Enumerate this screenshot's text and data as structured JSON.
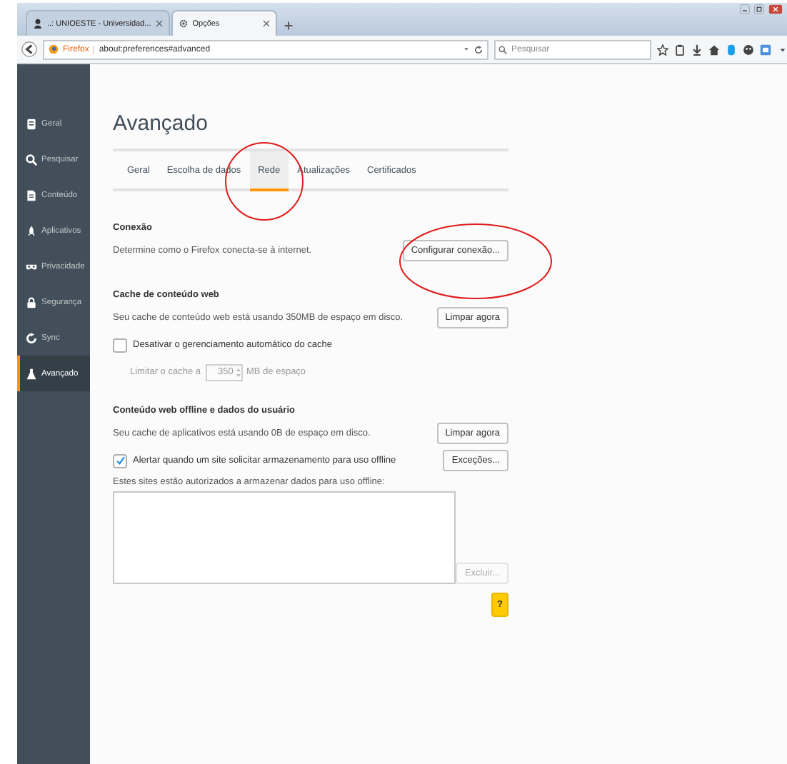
{
  "browser": {
    "tabs": [
      {
        "label": "..: UNIOESTE - Universidad...",
        "selected": false
      },
      {
        "label": "Opções",
        "selected": true
      }
    ],
    "toolbar": {
      "identity": "Firefox",
      "url": "about:preferences#advanced",
      "search": {
        "placeholder": "Pesquisar"
      }
    }
  },
  "sidebar": {
    "items": [
      {
        "label": "Geral",
        "selected": false
      },
      {
        "label": "Pesquisar",
        "selected": false
      },
      {
        "label": "Conteúdo",
        "selected": false
      },
      {
        "label": "Aplicativos",
        "selected": false
      },
      {
        "label": "Privacidade",
        "selected": false
      },
      {
        "label": "Segurança",
        "selected": false
      },
      {
        "label": "Sync",
        "selected": false
      },
      {
        "label": "Avançado",
        "selected": true
      }
    ]
  },
  "page": {
    "title": "Avançado",
    "tabs": [
      {
        "label": "Geral",
        "selected": false
      },
      {
        "label": "Escolha de dados",
        "selected": false
      },
      {
        "label": "Rede",
        "selected": true
      },
      {
        "label": "Atualizações",
        "selected": false
      },
      {
        "label": "Certificados",
        "selected": false
      }
    ],
    "connection": {
      "heading": "Conexão",
      "description": "Determine como o Firefox conecta-se à internet.",
      "button": "Configurar conexão..."
    },
    "cache": {
      "heading": "Cache de conteúdo web",
      "description": "Seu cache de conteúdo web está usando 350MB de espaço em disco.",
      "button": "Limpar agora",
      "checkbox": {
        "label": "Desativar o gerenciamento automático do cache",
        "checked": false
      },
      "limit": {
        "label": "Limitar o cache a",
        "value": "350",
        "unit": "MB de espaço",
        "disabled": true
      }
    },
    "offline": {
      "heading": "Conteúdo web offline e dados do usuário",
      "description": "Seu cache de aplicativos está usando 0B de espaço em disco.",
      "button": "Limpar agora",
      "checkbox": {
        "label": "Alertar quando um site solicitar armazenamento para uso offline",
        "checked": true
      },
      "exceptions_button": "Exceções...",
      "list_label": "Estes sites estão autorizados a armazenar dados para uso offline:",
      "remove_button": {
        "label": "Excluir...",
        "disabled": true
      },
      "help_button": "?"
    }
  }
}
